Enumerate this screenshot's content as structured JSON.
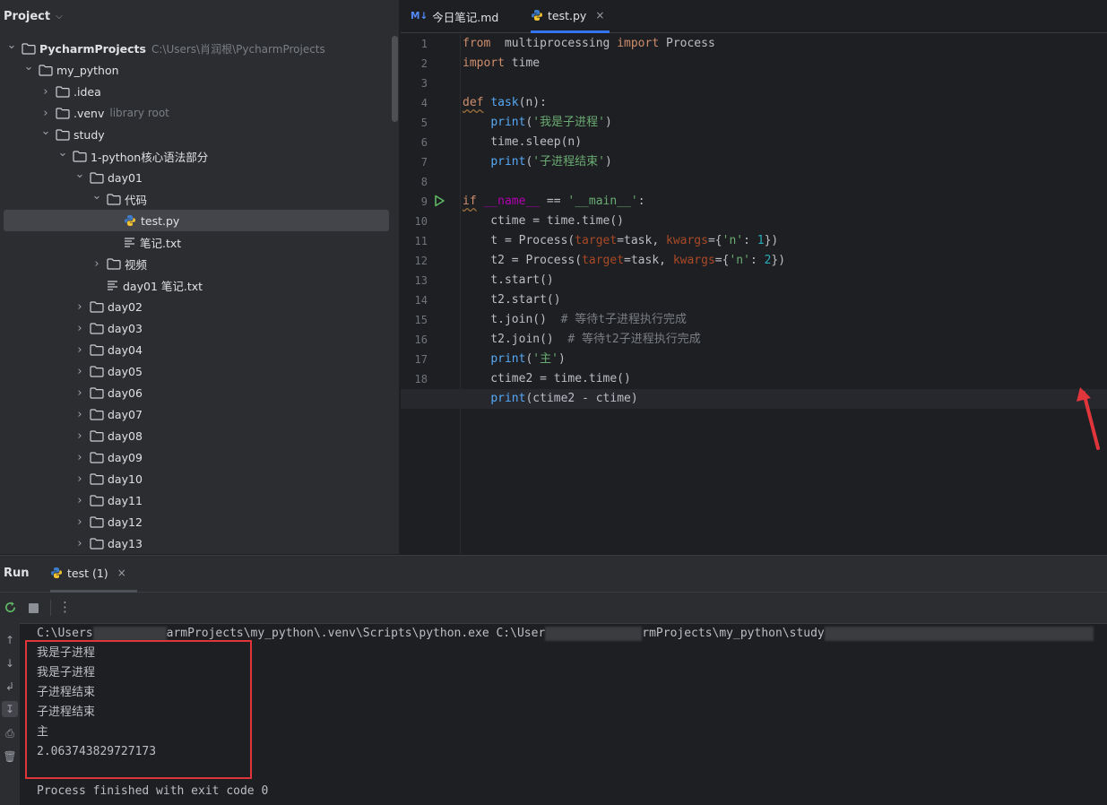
{
  "project_panel": {
    "title": "Project",
    "tree": [
      {
        "label": "PycharmProjects",
        "hint": "C:\\Users\\肖润根\\PycharmProjects",
        "type": "folder",
        "depth": 0,
        "expanded": true
      },
      {
        "label": "my_python",
        "type": "folder",
        "depth": 1,
        "expanded": true
      },
      {
        "label": ".idea",
        "type": "folder",
        "depth": 2,
        "expanded": false
      },
      {
        "label": ".venv",
        "hint": "library root",
        "type": "folder",
        "depth": 2,
        "expanded": false
      },
      {
        "label": "study",
        "type": "folder",
        "depth": 2,
        "expanded": true
      },
      {
        "label": "1-python核心语法部分",
        "type": "folder",
        "depth": 3,
        "expanded": true
      },
      {
        "label": "day01",
        "type": "folder",
        "depth": 4,
        "expanded": true
      },
      {
        "label": "代码",
        "type": "folder",
        "depth": 5,
        "expanded": true
      },
      {
        "label": "test.py",
        "type": "python",
        "depth": 6,
        "selected": true
      },
      {
        "label": "笔记.txt",
        "type": "text",
        "depth": 6
      },
      {
        "label": "视频",
        "type": "folder",
        "depth": 5,
        "expanded": false
      },
      {
        "label": "day01 笔记.txt",
        "type": "text",
        "depth": 5
      },
      {
        "label": "day02",
        "type": "folder",
        "depth": 4,
        "expanded": false
      },
      {
        "label": "day03",
        "type": "folder",
        "depth": 4,
        "expanded": false
      },
      {
        "label": "day04",
        "type": "folder",
        "depth": 4,
        "expanded": false
      },
      {
        "label": "day05",
        "type": "folder",
        "depth": 4,
        "expanded": false
      },
      {
        "label": "day06",
        "type": "folder",
        "depth": 4,
        "expanded": false
      },
      {
        "label": "day07",
        "type": "folder",
        "depth": 4,
        "expanded": false
      },
      {
        "label": "day08",
        "type": "folder",
        "depth": 4,
        "expanded": false
      },
      {
        "label": "day09",
        "type": "folder",
        "depth": 4,
        "expanded": false
      },
      {
        "label": "day10",
        "type": "folder",
        "depth": 4,
        "expanded": false
      },
      {
        "label": "day11",
        "type": "folder",
        "depth": 4,
        "expanded": false
      },
      {
        "label": "day12",
        "type": "folder",
        "depth": 4,
        "expanded": false
      },
      {
        "label": "day13",
        "type": "folder",
        "depth": 4,
        "expanded": false
      }
    ]
  },
  "editor": {
    "tabs": [
      {
        "badge": "M↓",
        "label": "今日笔记.md",
        "active": false
      },
      {
        "label": "test.py",
        "active": true,
        "close": "×"
      }
    ],
    "current_line": 19,
    "lines": [
      [
        [
          "kw",
          "from"
        ],
        [
          "",
          "  multiprocessing "
        ],
        [
          "kw",
          "import"
        ],
        [
          "",
          " Process"
        ]
      ],
      [
        [
          "kw",
          "import"
        ],
        [
          "",
          " time"
        ]
      ],
      [],
      [
        [
          "kw squiggle",
          "def"
        ],
        [
          "",
          " "
        ],
        [
          "fn",
          "task"
        ],
        [
          "",
          "(n):"
        ]
      ],
      [
        [
          "",
          "    "
        ],
        [
          "fn",
          "print"
        ],
        [
          "",
          "("
        ],
        [
          "str",
          "'我是子进程'"
        ],
        [
          "",
          ")"
        ]
      ],
      [
        [
          "",
          "    time.sleep(n)"
        ]
      ],
      [
        [
          "",
          "    "
        ],
        [
          "fn",
          "print"
        ],
        [
          "",
          "("
        ],
        [
          "str",
          "'子进程结束'"
        ],
        [
          "",
          ")"
        ]
      ],
      [],
      [
        [
          "kw squiggle",
          "if"
        ],
        [
          "",
          " "
        ],
        [
          "dunder",
          "__name__"
        ],
        [
          "",
          " == "
        ],
        [
          "str",
          "'__main__'"
        ],
        [
          "",
          ":"
        ]
      ],
      [
        [
          "",
          "    ctime = time.time()"
        ]
      ],
      [
        [
          "",
          "    t = Process("
        ],
        [
          "kwarg",
          "target"
        ],
        [
          "",
          "=task, "
        ],
        [
          "kwarg",
          "kwargs"
        ],
        [
          "",
          "={"
        ],
        [
          "str",
          "'n'"
        ],
        [
          "",
          ": "
        ],
        [
          "num",
          "1"
        ],
        [
          "",
          "})"
        ]
      ],
      [
        [
          "",
          "    t2 = Process("
        ],
        [
          "kwarg",
          "target"
        ],
        [
          "",
          "=task, "
        ],
        [
          "kwarg",
          "kwargs"
        ],
        [
          "",
          "={"
        ],
        [
          "str",
          "'n'"
        ],
        [
          "",
          ": "
        ],
        [
          "num",
          "2"
        ],
        [
          "",
          "})"
        ]
      ],
      [
        [
          "",
          "    t.start()"
        ]
      ],
      [
        [
          "",
          "    t2.start()"
        ]
      ],
      [
        [
          "",
          "    t.join()  "
        ],
        [
          "cmt",
          "# 等待t子进程执行完成"
        ]
      ],
      [
        [
          "",
          "    t2.join()  "
        ],
        [
          "cmt",
          "# 等待t2子进程执行完成"
        ]
      ],
      [
        [
          "",
          "    "
        ],
        [
          "fn",
          "print"
        ],
        [
          "",
          "("
        ],
        [
          "str",
          "'主'"
        ],
        [
          "",
          ")"
        ]
      ],
      [
        [
          "",
          "    ctime2 = time.time()"
        ]
      ],
      [
        [
          "",
          "    "
        ],
        [
          "fn",
          "print"
        ],
        [
          "",
          "(ctime2 - ctime)"
        ]
      ]
    ]
  },
  "run_panel": {
    "title": "Run",
    "tab_label": "test (1)",
    "tab_close": "×",
    "command": {
      "part1": "C:\\Users",
      "part2": "armProjects\\my_python\\.venv\\Scripts\\python.exe C:\\User",
      "part3": "rmProjects\\my_python\\study"
    },
    "output": [
      "我是子进程",
      "我是子进程",
      "子进程结束",
      "子进程结束",
      "主",
      "2.063743829727173"
    ],
    "exit_message": "Process finished with exit code 0"
  },
  "colors": {
    "annotation_red": "#e0353a",
    "accent_blue": "#3574f0"
  }
}
